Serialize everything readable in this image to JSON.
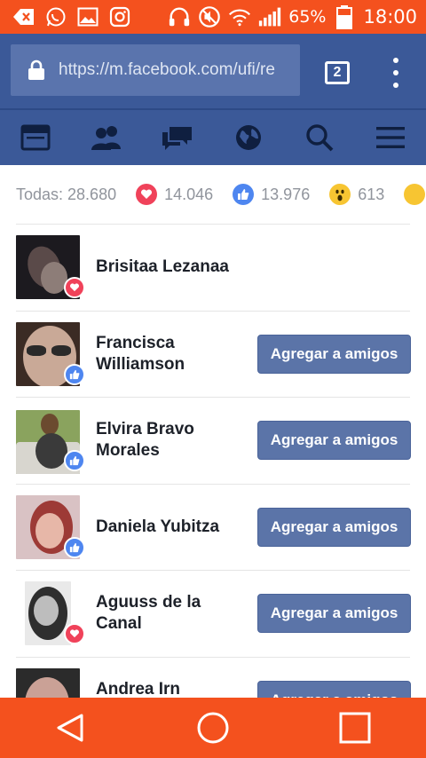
{
  "status_bar": {
    "battery": "65%",
    "time": "18:00",
    "left_icons": [
      "back-notification-icon",
      "whatsapp-icon",
      "gallery-icon",
      "instagram-icon"
    ],
    "right_icons": [
      "headphones-icon",
      "mute-icon",
      "wifi-icon",
      "signal-icon",
      "battery-icon"
    ]
  },
  "browser": {
    "url": "https://m.facebook.com/ufi/re",
    "tab_count": "2"
  },
  "fb_nav": {
    "items": [
      "news-feed-icon",
      "friends-icon",
      "messages-icon",
      "notifications-globe-icon",
      "search-icon",
      "menu-icon"
    ]
  },
  "summary": {
    "all_label": "Todas: 28.680",
    "love_count": "14.046",
    "like_count": "13.976",
    "wow_count": "613"
  },
  "people": [
    {
      "name": "Brisitaa Lezanaa",
      "reaction": "love",
      "button": ""
    },
    {
      "name": "Francisca Williamson",
      "reaction": "like",
      "button": "Agregar a amigos"
    },
    {
      "name": "Elvira Bravo Morales",
      "reaction": "like",
      "button": "Agregar a amigos"
    },
    {
      "name": "Daniela Yubitza",
      "reaction": "like",
      "button": "Agregar a amigos"
    },
    {
      "name": "Aguuss de la Canal",
      "reaction": "love",
      "button": "Agregar a amigos"
    },
    {
      "name": "Andrea Irn",
      "reaction": "",
      "button": "Agregar a amigos"
    }
  ],
  "colors": {
    "status_bar": "#f4511e",
    "facebook_blue": "#3b5998",
    "button_blue": "#5b74a8",
    "love": "#f0425a",
    "like": "#4e86f0",
    "wow": "#f7c532"
  }
}
